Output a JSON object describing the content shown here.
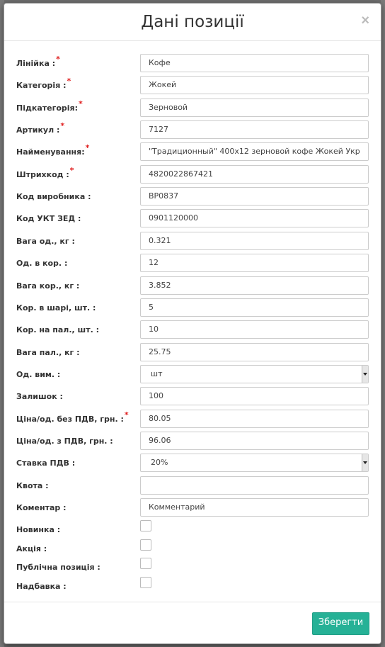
{
  "modal": {
    "title": "Дані позиції",
    "close": "×",
    "save_label": "Зберегти"
  },
  "fields": [
    {
      "label": "Лінійка :",
      "required": true,
      "value": "Кофе"
    },
    {
      "label": "Категорія :",
      "required": true,
      "value": "Жокей"
    },
    {
      "label": "Підкатегорія:",
      "required": true,
      "value": "Зерновой"
    },
    {
      "label": "Артикул :",
      "required": true,
      "value": "7127"
    },
    {
      "label": "Найменування:",
      "required": true,
      "value": "\"Традиционный\"  400х12 зерновой кофе Жокей Укр"
    },
    {
      "label": "Штрихкод :",
      "required": true,
      "value": "4820022867421"
    },
    {
      "label": "Код виробника :",
      "required": false,
      "value": "BP0837"
    },
    {
      "label": "Код УКТ ЗЕД :",
      "required": false,
      "value": "0901120000"
    },
    {
      "label": "Вага од., кг :",
      "required": false,
      "value": "0.321"
    },
    {
      "label": "Од. в кор. :",
      "required": false,
      "value": "12"
    },
    {
      "label": "Вага кор., кг :",
      "required": false,
      "value": "3.852"
    },
    {
      "label": "Кор. в шарі, шт. :",
      "required": false,
      "value": "5"
    },
    {
      "label": "Кор. на пал., шт. :",
      "required": false,
      "value": "10"
    },
    {
      "label": "Вага пал., кг :",
      "required": false,
      "value": "25.75"
    },
    {
      "label": "Од. вим. :",
      "required": false,
      "value": "шт",
      "type": "select"
    },
    {
      "label": "Залишок :",
      "required": false,
      "value": "100"
    },
    {
      "label": "Ціна/од. без ПДВ, грн. :",
      "required": true,
      "value": "80.05"
    },
    {
      "label": "Ціна/од. з ПДВ, грн. :",
      "required": false,
      "value": "96.06"
    },
    {
      "label": "Ставка ПДВ :",
      "required": false,
      "value": "20%",
      "type": "select"
    },
    {
      "label": "Квота :",
      "required": false,
      "value": ""
    },
    {
      "label": "Коментар :",
      "required": false,
      "value": "Комментарий"
    }
  ],
  "checkboxes": [
    {
      "label": "Новинка :",
      "checked": false
    },
    {
      "label": "Акція :",
      "checked": false
    },
    {
      "label": "Публічна позиція :",
      "checked": false
    },
    {
      "label": "Надбавка :",
      "checked": false
    }
  ],
  "required_mark": "*",
  "colors": {
    "accent": "#26b196",
    "required": "#e02020"
  }
}
